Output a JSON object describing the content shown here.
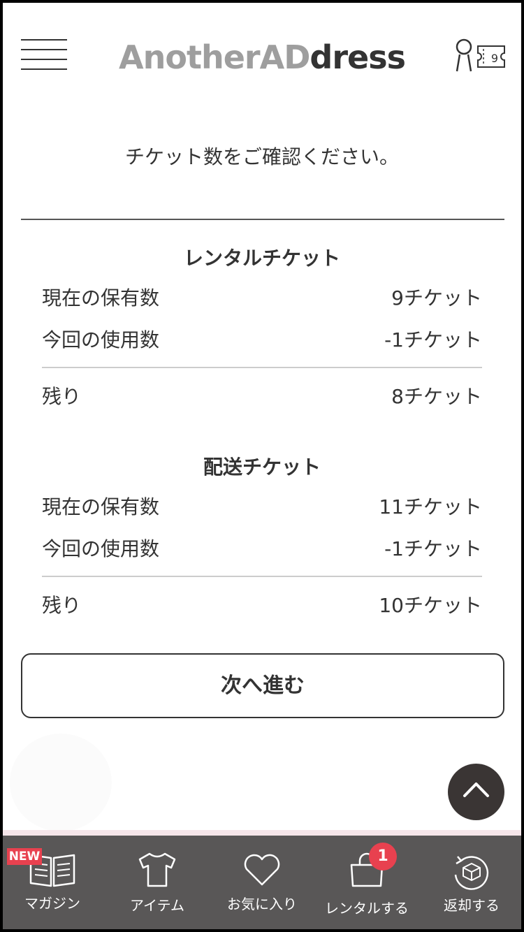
{
  "header": {
    "logo_part1": "AnotherAD",
    "logo_part2": "dress",
    "ticket_count": "9"
  },
  "intro": "チケット数をご確認ください。",
  "rental": {
    "title": "レンタルチケット",
    "rows": [
      {
        "label": "現在の保有数",
        "value": "9チケット"
      },
      {
        "label": "今回の使用数",
        "value": "-1チケット"
      },
      {
        "label": "残り",
        "value": "8チケット"
      }
    ]
  },
  "delivery": {
    "title": "配送チケット",
    "rows": [
      {
        "label": "現在の保有数",
        "value": "11チケット"
      },
      {
        "label": "今回の使用数",
        "value": "-1チケット"
      },
      {
        "label": "残り",
        "value": "10チケット"
      }
    ]
  },
  "next_button": "次へ進む",
  "bottom_nav": {
    "new_badge": "NEW",
    "cart_count": "1",
    "items": [
      {
        "label": "マガジン",
        "icon": "book-icon"
      },
      {
        "label": "アイテム",
        "icon": "tshirt-icon"
      },
      {
        "label": "お気に入り",
        "icon": "heart-icon"
      },
      {
        "label": "レンタルする",
        "icon": "bag-icon"
      },
      {
        "label": "返却する",
        "icon": "return-box-icon"
      }
    ]
  },
  "colors": {
    "nav_bg": "#595757",
    "badge": "#e8414f",
    "scroll_top_bg": "#3a3534",
    "logo_gray": "#9e9e9e"
  }
}
